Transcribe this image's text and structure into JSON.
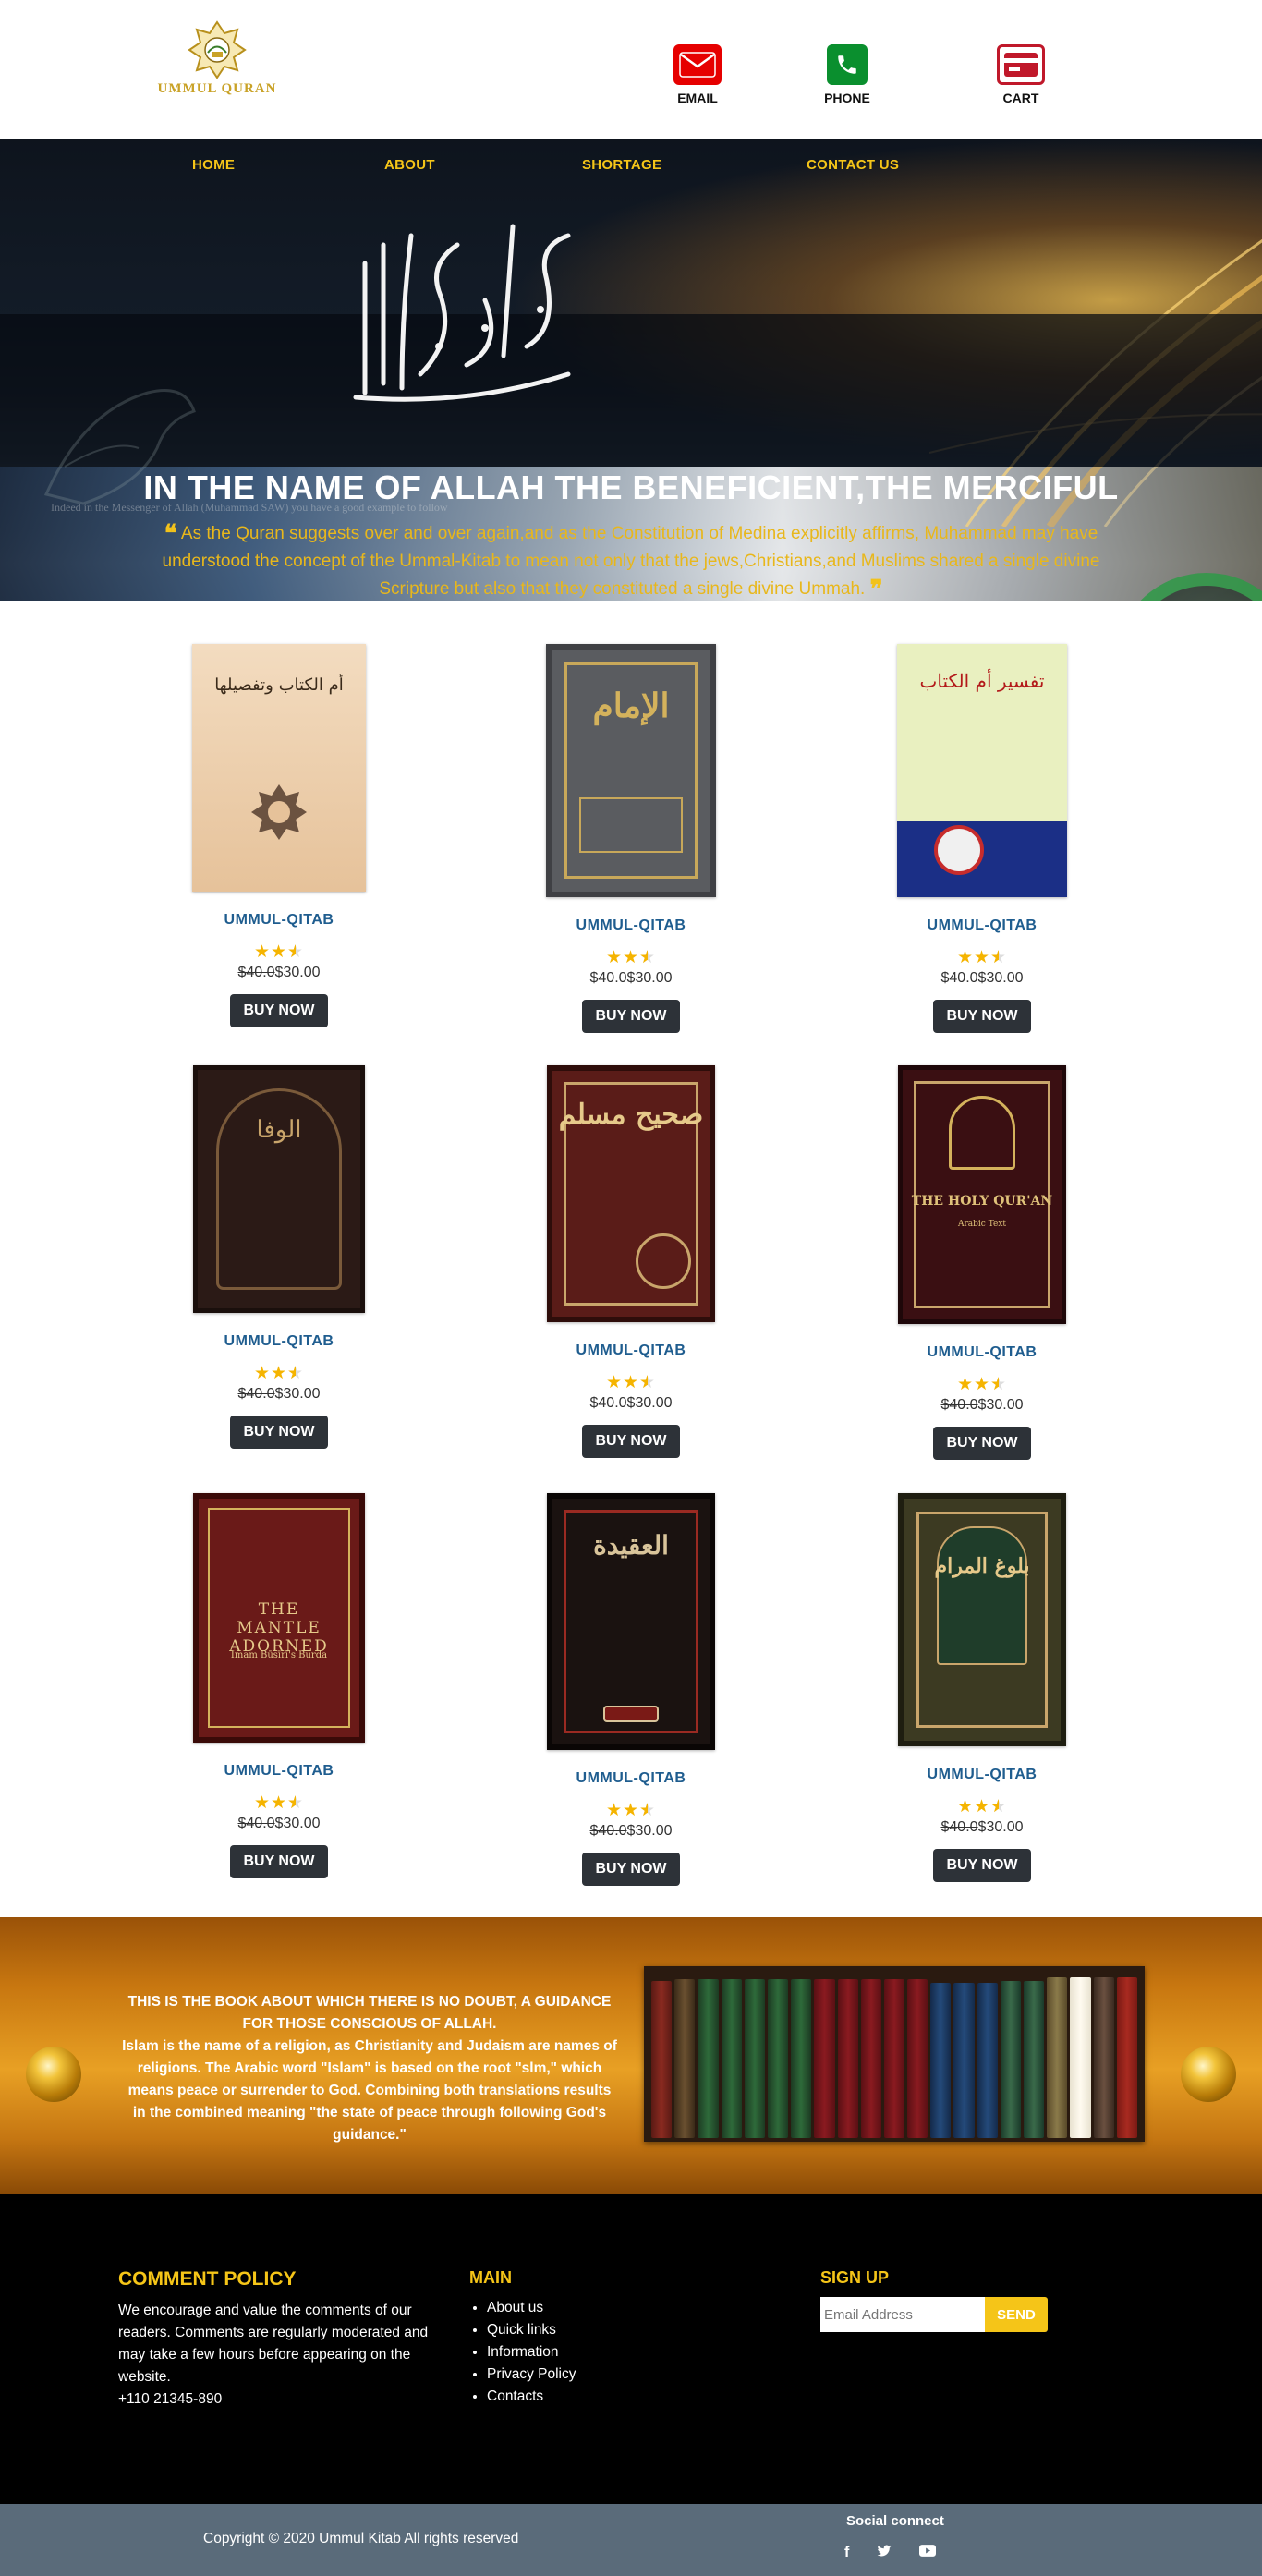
{
  "header": {
    "logo_text": "UMMUL QURAN",
    "contacts": [
      {
        "label": "EMAIL",
        "icon": "envelope-icon"
      },
      {
        "label": "PHONE",
        "icon": "phone-icon"
      },
      {
        "label": "CART",
        "icon": "credit-card-icon"
      }
    ]
  },
  "nav": {
    "items": [
      "HOME",
      "ABOUT",
      "SHORTAGE",
      "CONTACT US"
    ]
  },
  "hero": {
    "title": "IN THE NAME OF ALLAH THE BENEFICIENT,THE MERCIFUL",
    "quote": "As the Quran suggests over and over again,and as the Constitution of Medina explicitly affirms, Muhammad may have understood the concept of the Ummal-Kitab to mean not only that the jews,Christians,and Muslims shared a single divine Scripture but also that they constituted a single divine Ummah.",
    "background_caption": "Indeed in the Messenger of Allah (Muhammad SAW) you have a good example to follow"
  },
  "products": [
    {
      "title": "UMMUL-QITAB",
      "rating": 2.5,
      "old_price": "$40.0",
      "price": "$30.00",
      "button": "BUY NOW"
    },
    {
      "title": "UMMUL-QITAB",
      "rating": 2.5,
      "old_price": "$40.0",
      "price": "$30.00",
      "button": "BUY NOW"
    },
    {
      "title": "UMMUL-QITAB",
      "rating": 2.5,
      "old_price": "$40.0",
      "price": "$30.00",
      "button": "BUY NOW"
    },
    {
      "title": "UMMUL-QITAB",
      "rating": 2.5,
      "old_price": "$40.0",
      "price": "$30.00",
      "button": "BUY NOW"
    },
    {
      "title": "UMMUL-QITAB",
      "rating": 2.5,
      "old_price": "$40.0",
      "price": "$30.00",
      "button": "BUY NOW"
    },
    {
      "title": "UMMUL-QITAB",
      "rating": 2.5,
      "old_price": "$40.0",
      "price": "$30.00",
      "button": "BUY NOW"
    },
    {
      "title": "UMMUL-QITAB",
      "rating": 2.5,
      "old_price": "$40.0",
      "price": "$30.00",
      "button": "BUY NOW"
    },
    {
      "title": "UMMUL-QITAB",
      "rating": 2.5,
      "old_price": "$40.0",
      "price": "$30.00",
      "button": "BUY NOW"
    },
    {
      "title": "UMMUL-QITAB",
      "rating": 2.5,
      "old_price": "$40.0",
      "price": "$30.00",
      "button": "BUY NOW"
    }
  ],
  "book_covers": {
    "cover_1_title": "أم الكتاب وتفصيلها",
    "cover_2_title": "الإمام",
    "cover_3_title": "تفسير أم الكتاب",
    "cover_4_title": "الوفا",
    "cover_5_title": "صحيح مسلم",
    "cover_6_title": "THE HOLY QUR'AN",
    "cover_6_sub": "Arabic Text",
    "cover_7_title": "THE MANTLE ADORNED",
    "cover_7_sub": "Imam Būṣīrī's Burda",
    "cover_8_title": "العقيدة",
    "cover_9_title": "بلوغ المرام"
  },
  "banner": {
    "heading": "THIS IS THE BOOK ABOUT WHICH THERE IS NO DOUBT, A GUIDANCE FOR THOSE CONSCIOUS OF ALLAH.",
    "body": "Islam is the name of a religion, as Christianity and Judaism are names of religions. The Arabic word \"Islam\" is based on the root \"slm,\" which means peace or surrender to God. Combining both translations results in the combined meaning \"the state of peace through following God's guidance.\""
  },
  "footer": {
    "comment_policy": {
      "title": "COMMENT POLICY",
      "text": "We encourage and value the comments of our readers. Comments are regularly moderated and may take a few hours before appearing on the website.",
      "phone": "+110 21345-890"
    },
    "main": {
      "title": "MAIN",
      "links": [
        "About us",
        "Quick links",
        "Information",
        "Privacy Policy",
        "Contacts"
      ]
    },
    "signup": {
      "title": "SIGN UP",
      "placeholder": "Email Address",
      "button": "SEND"
    }
  },
  "bottom_bar": {
    "copyright": "Copyright © 2020 Ummul Kitab All rights reserved",
    "social_label": "Social connect",
    "social_icons": [
      "facebook-icon",
      "twitter-icon",
      "youtube-icon"
    ]
  },
  "colors": {
    "accent_gold": "#f5c518",
    "title_blue": "#1f5d8f",
    "button_dark": "#2d3238",
    "email_red": "#e60000",
    "phone_green": "#0a8f2e",
    "footer_bar": "#5a6b7a"
  }
}
